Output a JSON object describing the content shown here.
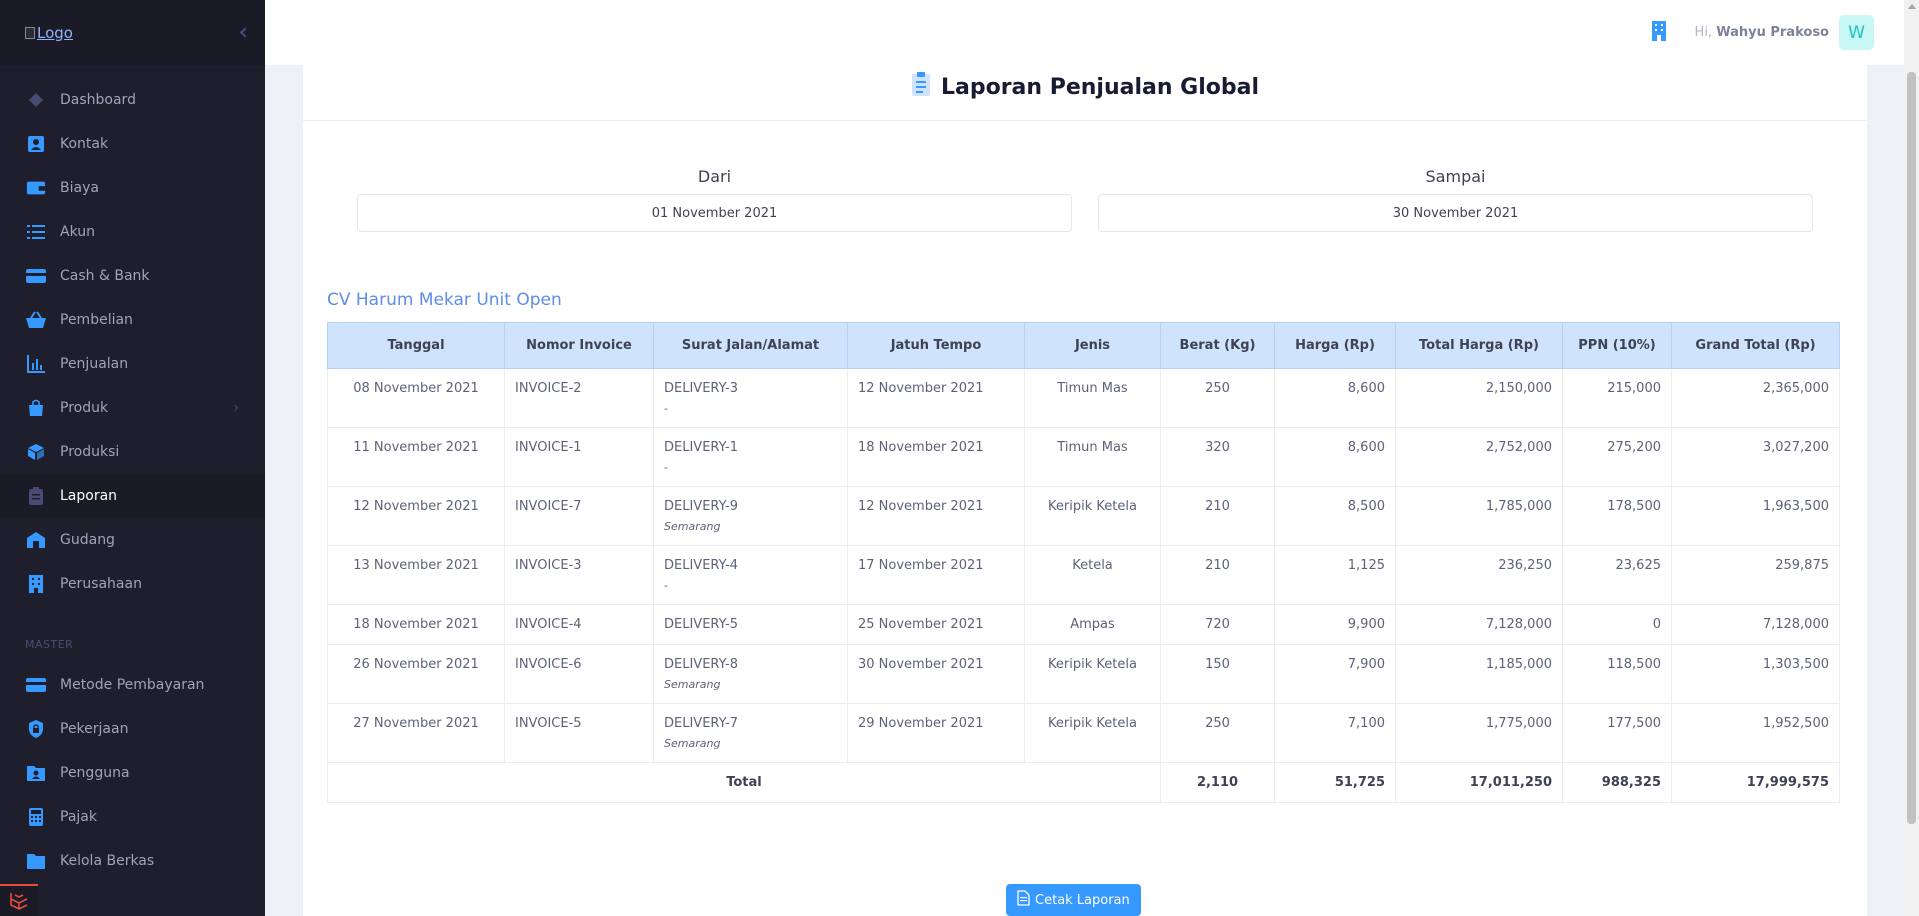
{
  "sidebar": {
    "logo_alt": "Logo",
    "items": [
      {
        "label": "Dashboard",
        "icon": "layers-icon"
      },
      {
        "label": "Kontak",
        "icon": "contact-icon"
      },
      {
        "label": "Biaya",
        "icon": "wallet-icon"
      },
      {
        "label": "Akun",
        "icon": "list-icon"
      },
      {
        "label": "Cash & Bank",
        "icon": "credit-card-icon"
      },
      {
        "label": "Pembelian",
        "icon": "basket-icon"
      },
      {
        "label": "Penjualan",
        "icon": "bar-chart-icon"
      },
      {
        "label": "Produk",
        "icon": "bag-icon"
      },
      {
        "label": "Produksi",
        "icon": "box-icon"
      },
      {
        "label": "Laporan",
        "icon": "clipboard-icon"
      },
      {
        "label": "Gudang",
        "icon": "warehouse-icon"
      },
      {
        "label": "Perusahaan",
        "icon": "building-icon"
      }
    ],
    "section_master": "MASTER",
    "master_items": [
      {
        "label": "Metode Pembayaran",
        "icon": "credit-card-icon"
      },
      {
        "label": "Pekerjaan",
        "icon": "shield-lock-icon"
      },
      {
        "label": "Pengguna",
        "icon": "user-folder-icon"
      },
      {
        "label": "Pajak",
        "icon": "calculator-icon"
      },
      {
        "label": "Kelola Berkas",
        "icon": "folder-icon"
      }
    ]
  },
  "header": {
    "greeting_prefix": "Hi,",
    "user_name": "Wahyu Prakoso",
    "avatar_initial": "W"
  },
  "report": {
    "title": "Laporan Penjualan Global",
    "from_label": "Dari",
    "from_value": "01 November 2021",
    "to_label": "Sampai",
    "to_value": "30 November 2021",
    "company": "CV Harum Mekar Unit Open",
    "columns": [
      "Tanggal",
      "Nomor Invoice",
      "Surat Jalan/Alamat",
      "Jatuh Tempo",
      "Jenis",
      "Berat (Kg)",
      "Harga (Rp)",
      "Total Harga (Rp)",
      "PPN (10%)",
      "Grand Total (Rp)"
    ],
    "rows": [
      [
        "08 November 2021",
        "INVOICE-2",
        "DELIVERY-3",
        "-",
        "12 November 2021",
        "Timun Mas",
        "250",
        "8,600",
        "2,150,000",
        "215,000",
        "2,365,000"
      ],
      [
        "11 November 2021",
        "INVOICE-1",
        "DELIVERY-1",
        "-",
        "18 November 2021",
        "Timun Mas",
        "320",
        "8,600",
        "2,752,000",
        "275,200",
        "3,027,200"
      ],
      [
        "12 November 2021",
        "INVOICE-7",
        "DELIVERY-9",
        "Semarang",
        "12 November 2021",
        "Keripik Ketela",
        "210",
        "8,500",
        "1,785,000",
        "178,500",
        "1,963,500"
      ],
      [
        "13 November 2021",
        "INVOICE-3",
        "DELIVERY-4",
        "-",
        "17 November 2021",
        "Ketela",
        "210",
        "1,125",
        "236,250",
        "23,625",
        "259,875"
      ],
      [
        "18 November 2021",
        "INVOICE-4",
        "DELIVERY-5",
        "",
        "25 November 2021",
        "Ampas",
        "720",
        "9,900",
        "7,128,000",
        "0",
        "7,128,000"
      ],
      [
        "26 November 2021",
        "INVOICE-6",
        "DELIVERY-8",
        "Semarang",
        "30 November 2021",
        "Keripik Ketela",
        "150",
        "7,900",
        "1,185,000",
        "118,500",
        "1,303,500"
      ],
      [
        "27 November 2021",
        "INVOICE-5",
        "DELIVERY-7",
        "Semarang",
        "29 November 2021",
        "Keripik Ketela",
        "250",
        "7,100",
        "1,775,000",
        "177,500",
        "1,952,500"
      ]
    ],
    "total": {
      "label": "Total",
      "berat": "2,110",
      "harga": "51,725",
      "total_harga": "17,011,250",
      "ppn": "988,325",
      "grand_total": "17,999,575"
    },
    "print_button": "Cetak Laporan"
  },
  "colors": {
    "sidebar_bg": "#1e1e2d",
    "accent": "#3699ff",
    "table_header_bg": "#cfe3fc",
    "company_text": "#5d8de8"
  }
}
